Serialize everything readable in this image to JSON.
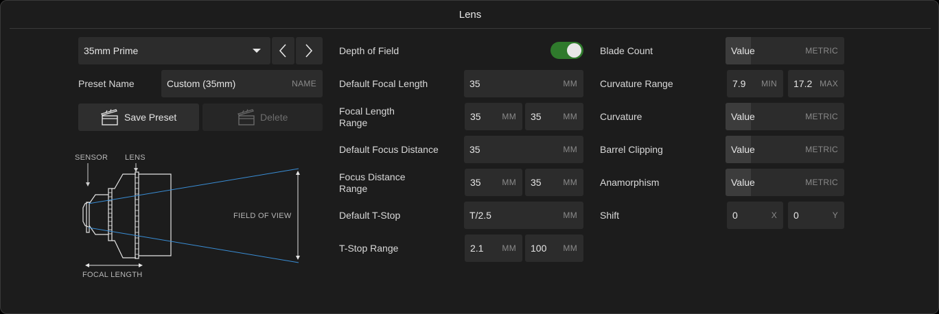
{
  "title": "Lens",
  "preset": {
    "selected": "35mm Prime",
    "name_label": "Preset Name",
    "name_value": "Custom (35mm)",
    "name_unit": "NAME",
    "save_label": "Save Preset",
    "delete_label": "Delete"
  },
  "diagram": {
    "sensor": "SENSOR",
    "lens": "LENS",
    "field_of_view": "FIELD OF VIEW",
    "focal_length": "FOCAL LENGTH"
  },
  "middle": {
    "depth_of_field": {
      "label": "Depth of Field",
      "enabled": true
    },
    "default_focal_length": {
      "label": "Default Focal Length",
      "value": "35",
      "unit": "MM"
    },
    "focal_length_range": {
      "label_line1": "Focal Length",
      "label_line2": "Range",
      "min": "35",
      "min_unit": "MM",
      "max": "35",
      "max_unit": "MM"
    },
    "default_focus_distance": {
      "label": "Default Focus Distance",
      "value": "35",
      "unit": "MM"
    },
    "focus_distance_range": {
      "label_line1": "Focus Distance",
      "label_line2": "Range",
      "min": "35",
      "min_unit": "MM",
      "max": "35",
      "max_unit": "MM"
    },
    "default_t_stop": {
      "label": "Default T-Stop",
      "value": "T/2.5",
      "unit": "MM"
    },
    "t_stop_range": {
      "label": "T-Stop Range",
      "min": "2.1",
      "min_unit": "MM",
      "max": "100",
      "max_unit": "MM"
    }
  },
  "right": {
    "blade_count": {
      "label": "Blade Count",
      "value": "Value",
      "unit": "METRIC"
    },
    "curvature_range": {
      "label": "Curvature Range",
      "min": "7.9",
      "min_unit": "MIN",
      "max": "17.2",
      "max_unit": "MAX"
    },
    "curvature": {
      "label": "Curvature",
      "value": "Value",
      "unit": "METRIC"
    },
    "barrel_clipping": {
      "label": "Barrel Clipping",
      "value": "Value",
      "unit": "METRIC"
    },
    "anamorphism": {
      "label": "Anamorphism",
      "value": "Value",
      "unit": "METRIC"
    },
    "shift": {
      "label": "Shift",
      "x": "0",
      "x_unit": "X",
      "y": "0",
      "y_unit": "Y"
    }
  },
  "colors": {
    "accent_toggle": "#2f7a2c",
    "ray": "#3a8fd8",
    "panel": "#1c1c1c",
    "field": "#2c2c2c"
  },
  "icons": {
    "dropdown": "caret-down-icon",
    "prev": "chevron-left-icon",
    "next": "chevron-right-icon",
    "save": "clapperboard-icon",
    "delete": "clapperboard-icon"
  }
}
